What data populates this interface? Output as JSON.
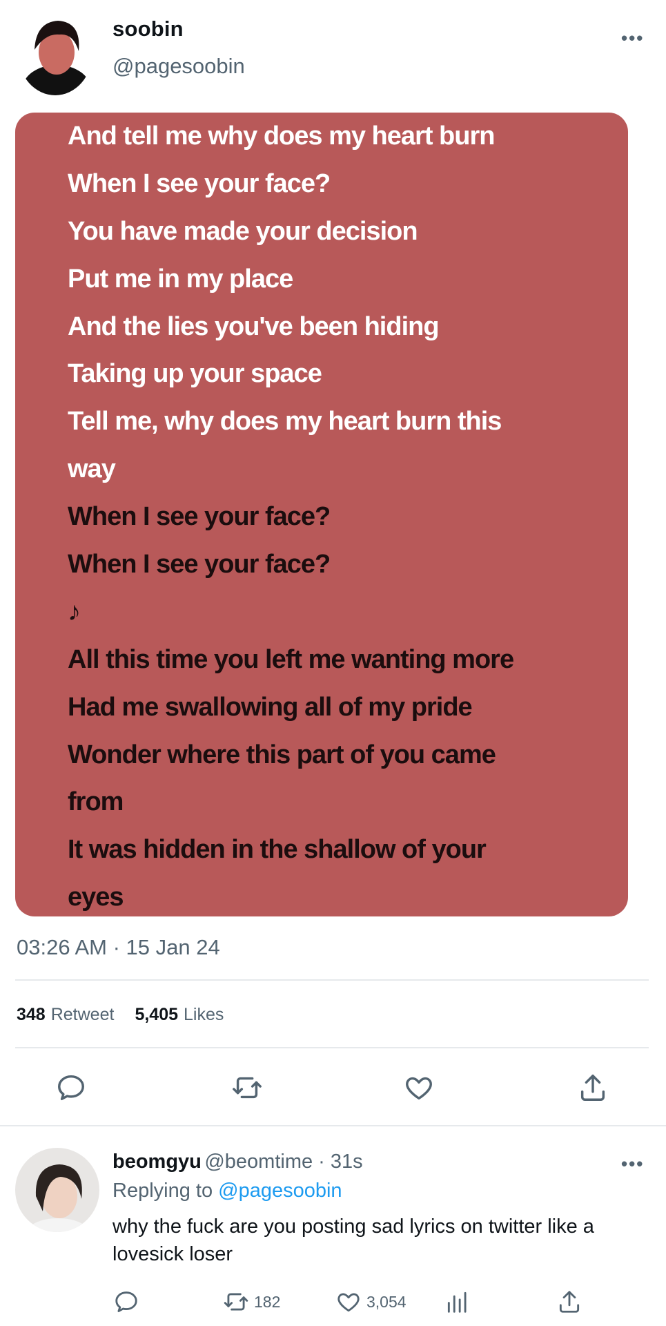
{
  "tweet": {
    "author_name": "soobin",
    "author_handle": "@pagesoobin",
    "lyrics": [
      {
        "text": "And tell me why does my heart burn",
        "active": true
      },
      {
        "text": "When I see your face?",
        "active": true
      },
      {
        "text": "You have made your decision",
        "active": true
      },
      {
        "text": "Put me in my place",
        "active": true
      },
      {
        "text": "And the lies you've been hiding",
        "active": true
      },
      {
        "text": "Taking up your space",
        "active": true
      },
      {
        "text": "Tell me, why does my heart burn this",
        "active": true
      },
      {
        "text": "way",
        "active": true
      },
      {
        "text": "When I see your face?",
        "active": false
      },
      {
        "text": "When I see your face?",
        "active": false
      },
      {
        "text": "♪",
        "active": false
      },
      {
        "text": "All this time you left me wanting more",
        "active": false
      },
      {
        "text": "Had me swallowing all of my pride",
        "active": false
      },
      {
        "text": "Wonder where this part of you came",
        "active": false
      },
      {
        "text": "from",
        "active": false
      },
      {
        "text": "It was hidden in the shallow of your",
        "active": false
      },
      {
        "text": "eyes",
        "active": false
      }
    ],
    "card_color": "#b85959",
    "timestamp": "03:26 AM · 15 Jan 24",
    "retweet_count": "348",
    "retweet_label": "Retweet",
    "like_count": "5,405",
    "like_label": "Likes"
  },
  "reply": {
    "author_name": "beomgyu",
    "author_handle": "@beomtime · 31s",
    "replying_prefix": "Replying to",
    "replying_handle": "@pagesoobin",
    "text": "why the fuck are you posting sad lyrics on twitter like a lovesick loser",
    "retweet_count": "182",
    "like_count": "3,054"
  },
  "icons": {
    "more": "more-horizontal-icon",
    "reply": "speech-bubble-icon",
    "retweet": "retweet-arrows-icon",
    "like": "heart-icon",
    "share": "share-upload-icon",
    "views": "bar-chart-icon"
  },
  "colors": {
    "mention": "#1d9bf0",
    "secondary_text": "#536471"
  }
}
